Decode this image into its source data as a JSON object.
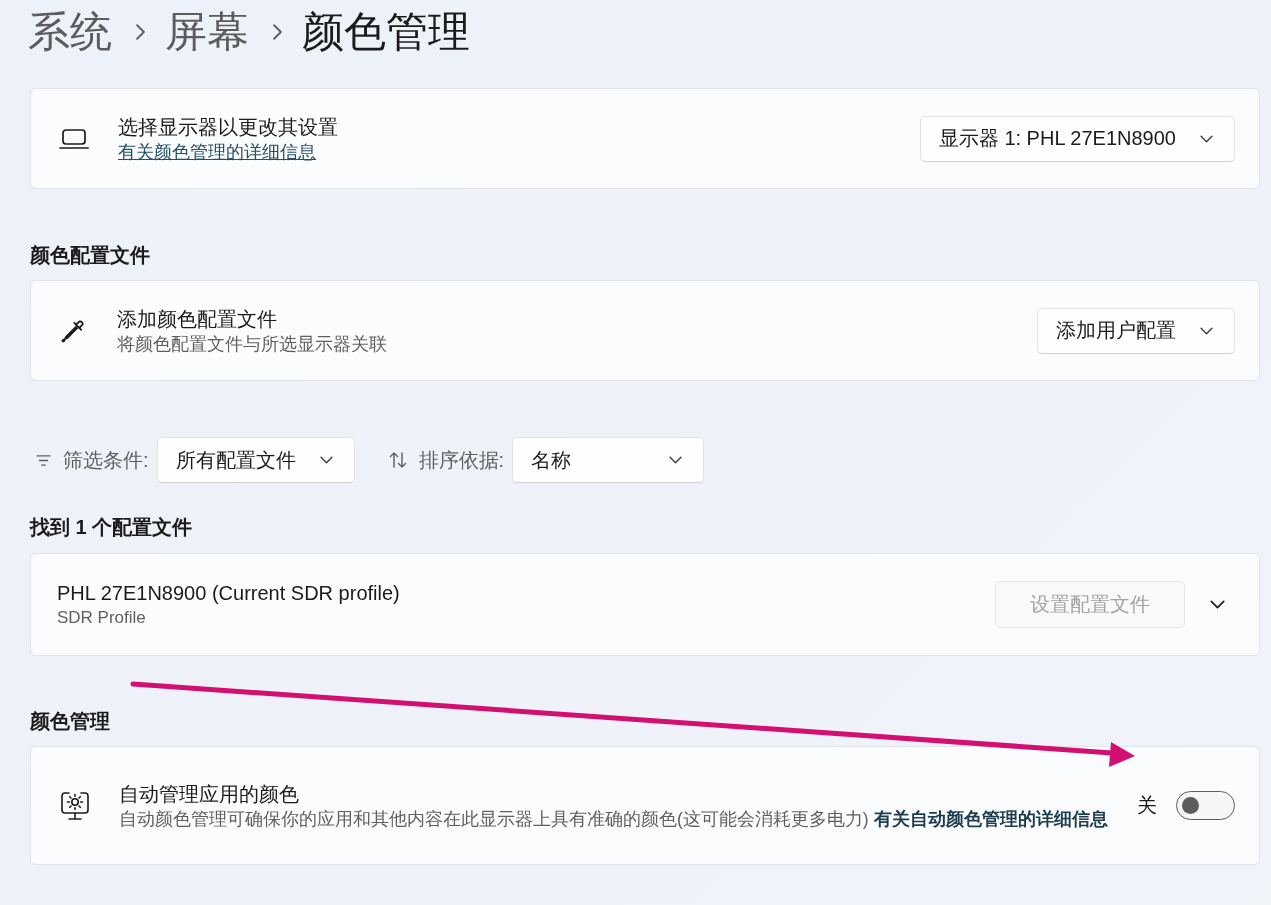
{
  "breadcrumb": [
    {
      "label": "系统",
      "current": false
    },
    {
      "label": "屏幕",
      "current": false
    },
    {
      "label": "颜色管理",
      "current": true
    }
  ],
  "display_card": {
    "title": "选择显示器以更改其设置",
    "link": "有关颜色管理的详细信息",
    "dropdown": {
      "value": "显示器 1: PHL 27E1N8900"
    }
  },
  "color_profiles": {
    "heading": "颜色配置文件",
    "add_card": {
      "title": "添加颜色配置文件",
      "description": "将颜色配置文件与所选显示器关联",
      "dropdown": {
        "value": "添加用户配置"
      }
    }
  },
  "filters": [
    {
      "kind": "filter",
      "label": "筛选条件:",
      "value": "所有配置文件"
    },
    {
      "kind": "sort",
      "label": "排序依据:",
      "value": "名称"
    }
  ],
  "results": {
    "heading": "找到 1 个配置文件",
    "profiles": [
      {
        "name": "PHL 27E1N8900 (Current SDR profile)",
        "type": "SDR Profile",
        "button": {
          "label": "设置配置文件",
          "disabled": true
        },
        "expanded": false
      }
    ]
  },
  "color_management": {
    "heading": "颜色管理",
    "setting": {
      "title": "自动管理应用的颜色",
      "description": "自动颜色管理可确保你的应用和其他内容在此显示器上具有准确的颜色(这可能会消耗更多电力)",
      "link": "有关自动颜色管理的详细信息",
      "toggle": {
        "label": "关",
        "on": false
      }
    }
  },
  "annotation": {
    "kind": "arrow"
  }
}
